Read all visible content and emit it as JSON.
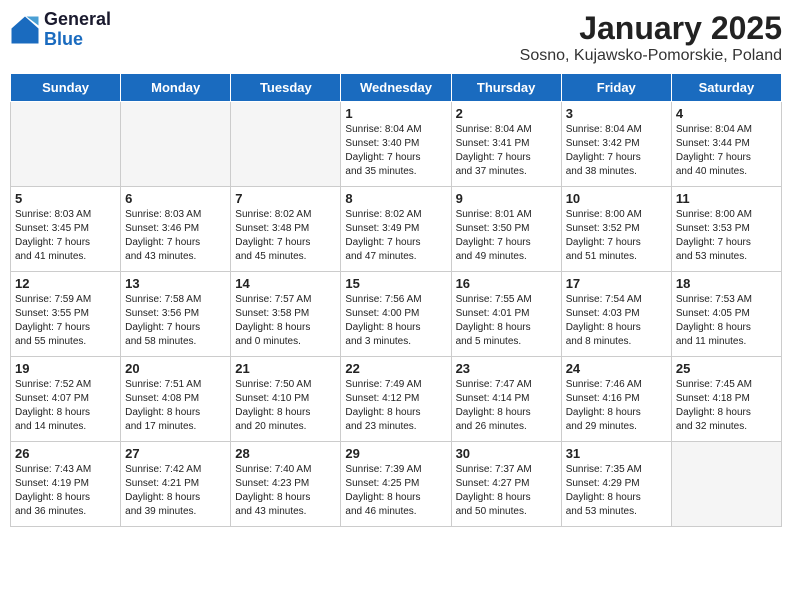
{
  "logo": {
    "general": "General",
    "blue": "Blue"
  },
  "title": "January 2025",
  "subtitle": "Sosno, Kujawsko-Pomorskie, Poland",
  "headers": [
    "Sunday",
    "Monday",
    "Tuesday",
    "Wednesday",
    "Thursday",
    "Friday",
    "Saturday"
  ],
  "weeks": [
    [
      {
        "num": "",
        "info": ""
      },
      {
        "num": "",
        "info": ""
      },
      {
        "num": "",
        "info": ""
      },
      {
        "num": "1",
        "info": "Sunrise: 8:04 AM\nSunset: 3:40 PM\nDaylight: 7 hours\nand 35 minutes."
      },
      {
        "num": "2",
        "info": "Sunrise: 8:04 AM\nSunset: 3:41 PM\nDaylight: 7 hours\nand 37 minutes."
      },
      {
        "num": "3",
        "info": "Sunrise: 8:04 AM\nSunset: 3:42 PM\nDaylight: 7 hours\nand 38 minutes."
      },
      {
        "num": "4",
        "info": "Sunrise: 8:04 AM\nSunset: 3:44 PM\nDaylight: 7 hours\nand 40 minutes."
      }
    ],
    [
      {
        "num": "5",
        "info": "Sunrise: 8:03 AM\nSunset: 3:45 PM\nDaylight: 7 hours\nand 41 minutes."
      },
      {
        "num": "6",
        "info": "Sunrise: 8:03 AM\nSunset: 3:46 PM\nDaylight: 7 hours\nand 43 minutes."
      },
      {
        "num": "7",
        "info": "Sunrise: 8:02 AM\nSunset: 3:48 PM\nDaylight: 7 hours\nand 45 minutes."
      },
      {
        "num": "8",
        "info": "Sunrise: 8:02 AM\nSunset: 3:49 PM\nDaylight: 7 hours\nand 47 minutes."
      },
      {
        "num": "9",
        "info": "Sunrise: 8:01 AM\nSunset: 3:50 PM\nDaylight: 7 hours\nand 49 minutes."
      },
      {
        "num": "10",
        "info": "Sunrise: 8:00 AM\nSunset: 3:52 PM\nDaylight: 7 hours\nand 51 minutes."
      },
      {
        "num": "11",
        "info": "Sunrise: 8:00 AM\nSunset: 3:53 PM\nDaylight: 7 hours\nand 53 minutes."
      }
    ],
    [
      {
        "num": "12",
        "info": "Sunrise: 7:59 AM\nSunset: 3:55 PM\nDaylight: 7 hours\nand 55 minutes."
      },
      {
        "num": "13",
        "info": "Sunrise: 7:58 AM\nSunset: 3:56 PM\nDaylight: 7 hours\nand 58 minutes."
      },
      {
        "num": "14",
        "info": "Sunrise: 7:57 AM\nSunset: 3:58 PM\nDaylight: 8 hours\nand 0 minutes."
      },
      {
        "num": "15",
        "info": "Sunrise: 7:56 AM\nSunset: 4:00 PM\nDaylight: 8 hours\nand 3 minutes."
      },
      {
        "num": "16",
        "info": "Sunrise: 7:55 AM\nSunset: 4:01 PM\nDaylight: 8 hours\nand 5 minutes."
      },
      {
        "num": "17",
        "info": "Sunrise: 7:54 AM\nSunset: 4:03 PM\nDaylight: 8 hours\nand 8 minutes."
      },
      {
        "num": "18",
        "info": "Sunrise: 7:53 AM\nSunset: 4:05 PM\nDaylight: 8 hours\nand 11 minutes."
      }
    ],
    [
      {
        "num": "19",
        "info": "Sunrise: 7:52 AM\nSunset: 4:07 PM\nDaylight: 8 hours\nand 14 minutes."
      },
      {
        "num": "20",
        "info": "Sunrise: 7:51 AM\nSunset: 4:08 PM\nDaylight: 8 hours\nand 17 minutes."
      },
      {
        "num": "21",
        "info": "Sunrise: 7:50 AM\nSunset: 4:10 PM\nDaylight: 8 hours\nand 20 minutes."
      },
      {
        "num": "22",
        "info": "Sunrise: 7:49 AM\nSunset: 4:12 PM\nDaylight: 8 hours\nand 23 minutes."
      },
      {
        "num": "23",
        "info": "Sunrise: 7:47 AM\nSunset: 4:14 PM\nDaylight: 8 hours\nand 26 minutes."
      },
      {
        "num": "24",
        "info": "Sunrise: 7:46 AM\nSunset: 4:16 PM\nDaylight: 8 hours\nand 29 minutes."
      },
      {
        "num": "25",
        "info": "Sunrise: 7:45 AM\nSunset: 4:18 PM\nDaylight: 8 hours\nand 32 minutes."
      }
    ],
    [
      {
        "num": "26",
        "info": "Sunrise: 7:43 AM\nSunset: 4:19 PM\nDaylight: 8 hours\nand 36 minutes."
      },
      {
        "num": "27",
        "info": "Sunrise: 7:42 AM\nSunset: 4:21 PM\nDaylight: 8 hours\nand 39 minutes."
      },
      {
        "num": "28",
        "info": "Sunrise: 7:40 AM\nSunset: 4:23 PM\nDaylight: 8 hours\nand 43 minutes."
      },
      {
        "num": "29",
        "info": "Sunrise: 7:39 AM\nSunset: 4:25 PM\nDaylight: 8 hours\nand 46 minutes."
      },
      {
        "num": "30",
        "info": "Sunrise: 7:37 AM\nSunset: 4:27 PM\nDaylight: 8 hours\nand 50 minutes."
      },
      {
        "num": "31",
        "info": "Sunrise: 7:35 AM\nSunset: 4:29 PM\nDaylight: 8 hours\nand 53 minutes."
      },
      {
        "num": "",
        "info": ""
      }
    ]
  ]
}
